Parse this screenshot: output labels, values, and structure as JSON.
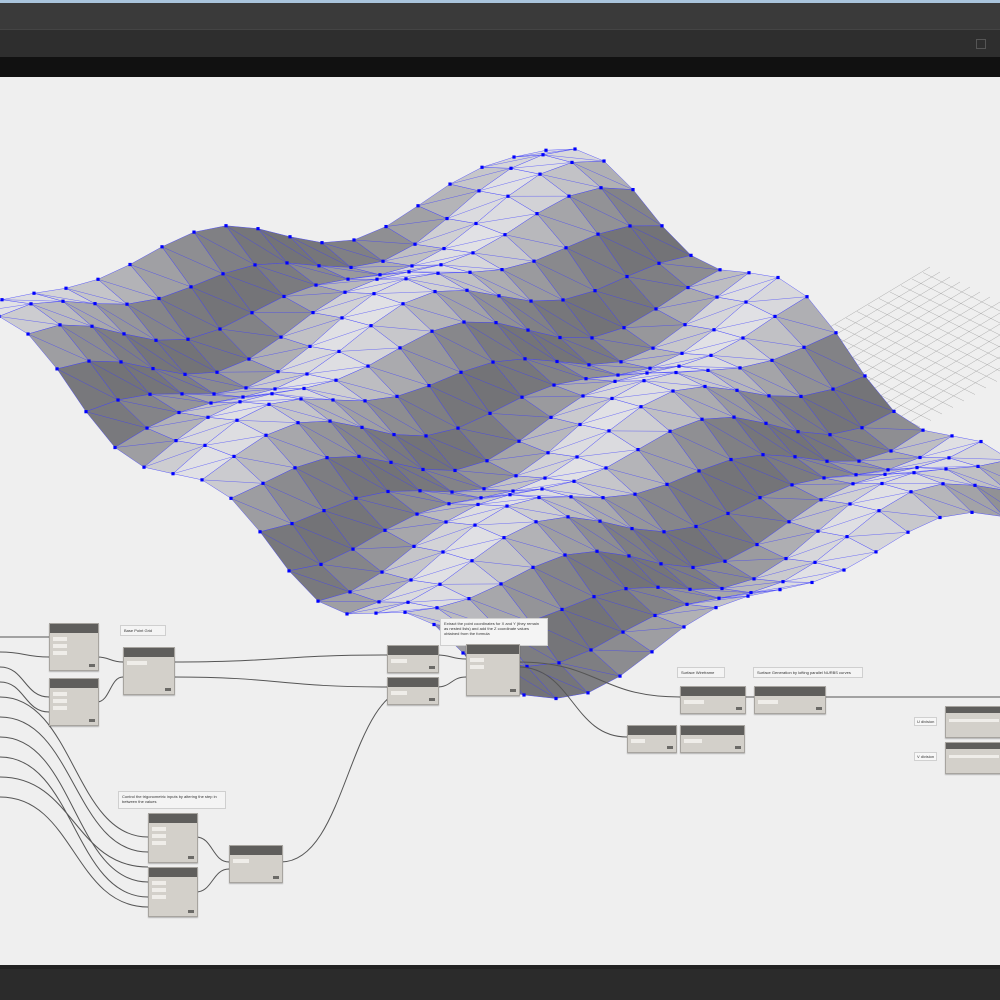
{
  "window": {
    "accent": "#a9c4dc"
  },
  "canvas": {
    "background": "#efefef"
  },
  "mesh": {
    "point_color": "#0000ff",
    "line_color": "#3b3bff"
  },
  "notes": {
    "base_point_grid": "Base Point Grid",
    "extract_coords": "Extract the point coordinates for X and Y (they remain as nested lists) and add the Z coordinate values obtained from the formula",
    "surface_wireframe": "Surface Wireframe",
    "surface_generation": "Surface Generation by lofting parallel NURBS curves",
    "trig_control": "Control the trigonometric inputs by altering the step in between the values",
    "u_division": "U division",
    "v_division": "V division"
  }
}
